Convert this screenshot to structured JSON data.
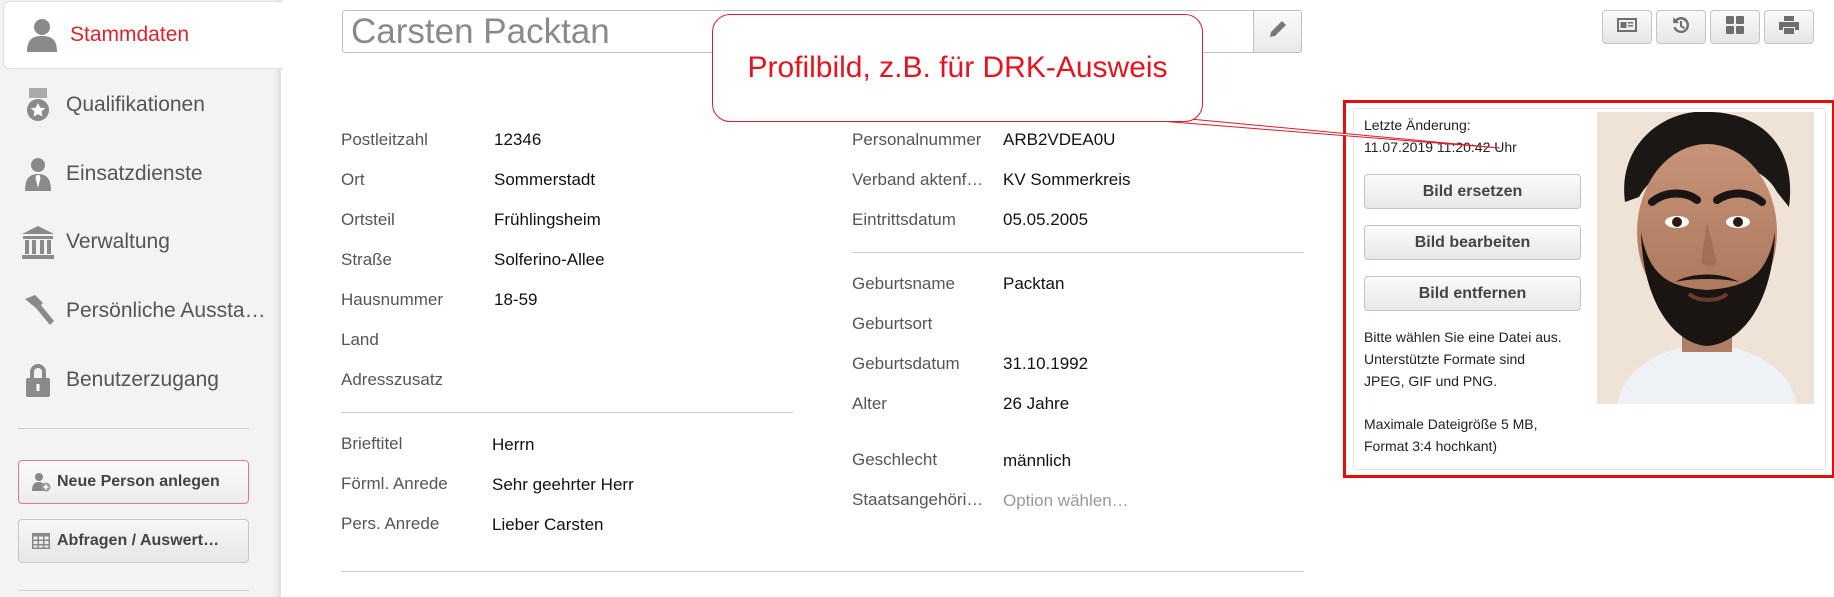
{
  "sidebar": {
    "items": [
      {
        "label": "Stammdaten",
        "icon": "person-icon",
        "active": true
      },
      {
        "label": "Qualifikationen",
        "icon": "medal-icon"
      },
      {
        "label": "Einsatzdienste",
        "icon": "person-tie-icon"
      },
      {
        "label": "Verwaltung",
        "icon": "bank-icon"
      },
      {
        "label": "Persönliche Aussta…",
        "icon": "hammer-icon"
      },
      {
        "label": "Benutzerzugang",
        "icon": "lock-icon"
      }
    ],
    "new_person_label": "Neue Person anlegen",
    "queries_label": "Abfragen / Auswert…"
  },
  "header": {
    "name": "Carsten Packtan"
  },
  "callout": {
    "text": "Profilbild, z.B. für DRK-Ausweis"
  },
  "address": {
    "postleitzahl_label": "Postleitzahl",
    "postleitzahl": "12346",
    "ort_label": "Ort",
    "ort": "Sommerstadt",
    "ortsteil_label": "Ortsteil",
    "ortsteil": "Frühlingsheim",
    "strasse_label": "Straße",
    "strasse": "Solferino-Allee",
    "hausnummer_label": "Hausnummer",
    "hausnummer": "18-59",
    "land_label": "Land",
    "land": "",
    "adresszusatz_label": "Adresszusatz",
    "adresszusatz": ""
  },
  "salutation": {
    "brieftitel_label": "Brieftitel",
    "brieftitel": "Herrn",
    "foerml_label": "Förml. Anrede",
    "foerml": "Sehr geehrter Herr",
    "pers_label": "Pers. Anrede",
    "pers": "Lieber Carsten"
  },
  "membership": {
    "personalnummer_label": "Personalnummer",
    "personalnummer": "ARB2VDEA0U",
    "verband_label": "Verband aktenf…",
    "verband": "KV Sommerkreis",
    "eintritt_label": "Eintrittsdatum",
    "eintritt": "05.05.2005"
  },
  "birth": {
    "geburtsname_label": "Geburtsname",
    "geburtsname": "Packtan",
    "geburtsort_label": "Geburtsort",
    "geburtsort": "",
    "geburtsdatum_label": "Geburtsdatum",
    "geburtsdatum": "31.10.1992",
    "alter_label": "Alter",
    "alter": "26 Jahre",
    "geschlecht_label": "Geschlecht",
    "geschlecht": "männlich",
    "staat_label": "Staatsangehöri…",
    "staat_placeholder": "Option wählen…"
  },
  "photo": {
    "last_change_label": "Letzte Änderung:",
    "last_change_value": "11.07.2019 11:20:42 Uhr",
    "replace_label": "Bild ersetzen",
    "edit_label": "Bild bearbeiten",
    "remove_label": "Bild entfernen",
    "hint_1": "Bitte wählen Sie eine Datei aus.",
    "hint_2": "Unterstützte Formate sind",
    "hint_3": "JPEG, GIF und PNG.",
    "hint_4": "Maximale Dateigröße 5 MB,",
    "hint_5": "Format 3:4 hochkant)"
  },
  "colors": {
    "accent": "#d9232d",
    "highlight_border": "#e01010"
  }
}
